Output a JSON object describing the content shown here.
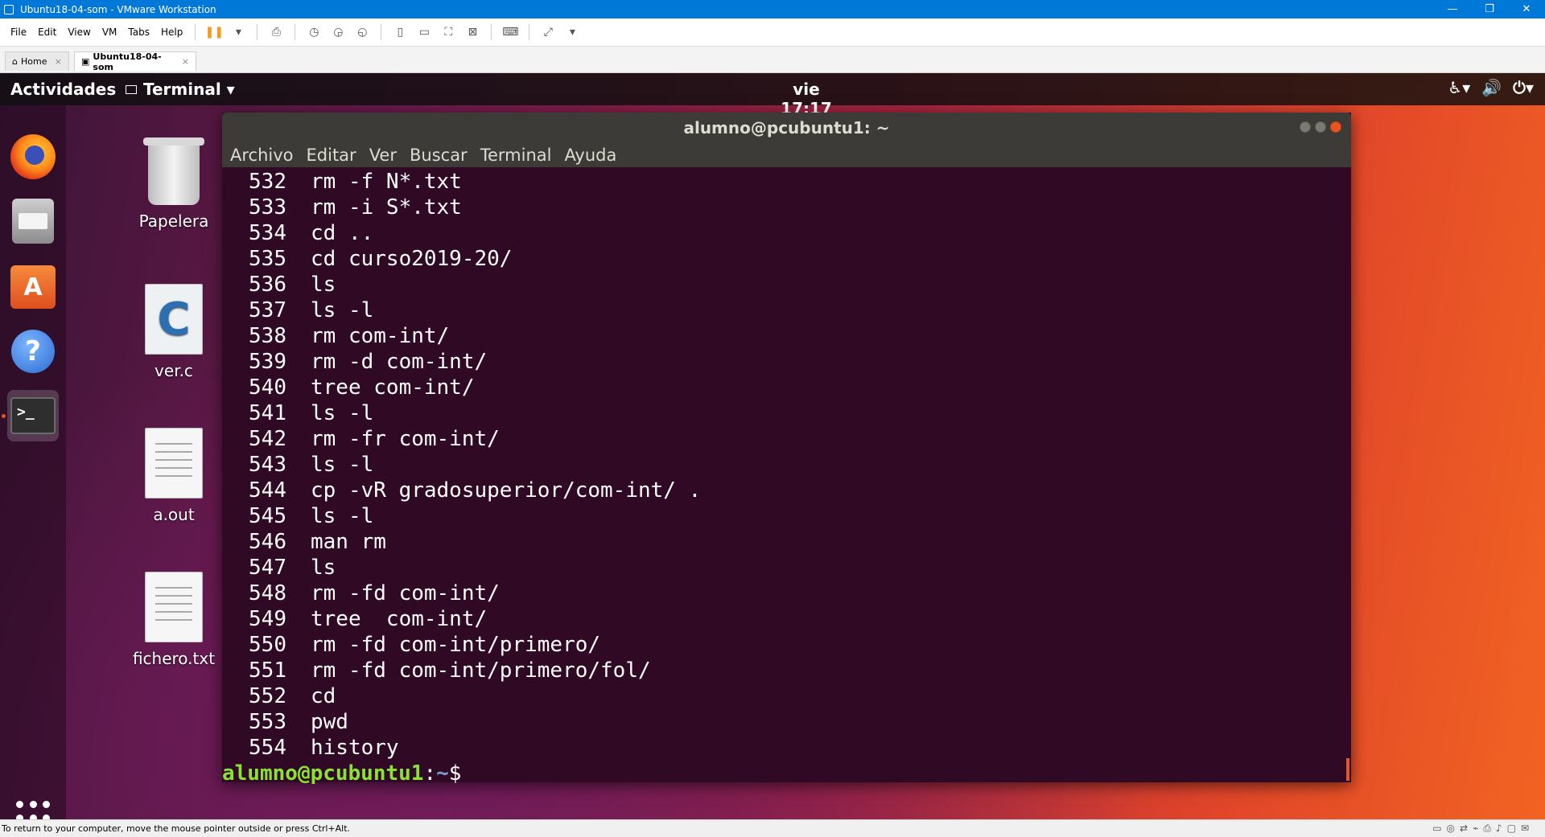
{
  "host": {
    "title": "Ubuntu18-04-som - VMware Workstation",
    "menu": [
      "File",
      "Edit",
      "View",
      "VM",
      "Tabs",
      "Help"
    ],
    "tabs": [
      {
        "label": "Home",
        "close": "×"
      },
      {
        "label": "Ubuntu18-04-som",
        "close": "×"
      }
    ],
    "status_message": "To return to your computer, move the mouse pointer outside or press Ctrl+Alt."
  },
  "gnome": {
    "activities": "Actividades",
    "app_menu": "Terminal ▾",
    "clock": "vie 17:17"
  },
  "desktop": {
    "icons": [
      {
        "label": "Papelera"
      },
      {
        "label": "ver.c"
      },
      {
        "label": "a.out"
      },
      {
        "label": "fichero.txt"
      }
    ]
  },
  "terminal": {
    "title": "alumno@pcubuntu1: ~",
    "menu": [
      "Archivo",
      "Editar",
      "Ver",
      "Buscar",
      "Terminal",
      "Ayuda"
    ],
    "history": [
      {
        "num": "532",
        "cmd": "rm -f N*.txt"
      },
      {
        "num": "533",
        "cmd": "rm -i S*.txt"
      },
      {
        "num": "534",
        "cmd": "cd .."
      },
      {
        "num": "535",
        "cmd": "cd curso2019-20/"
      },
      {
        "num": "536",
        "cmd": "ls"
      },
      {
        "num": "537",
        "cmd": "ls -l"
      },
      {
        "num": "538",
        "cmd": "rm com-int/"
      },
      {
        "num": "539",
        "cmd": "rm -d com-int/"
      },
      {
        "num": "540",
        "cmd": "tree com-int/"
      },
      {
        "num": "541",
        "cmd": "ls -l"
      },
      {
        "num": "542",
        "cmd": "rm -fr com-int/"
      },
      {
        "num": "543",
        "cmd": "ls -l"
      },
      {
        "num": "544",
        "cmd": "cp -vR gradosuperior/com-int/ ."
      },
      {
        "num": "545",
        "cmd": "ls -l"
      },
      {
        "num": "546",
        "cmd": "man rm"
      },
      {
        "num": "547",
        "cmd": "ls"
      },
      {
        "num": "548",
        "cmd": "rm -fd com-int/"
      },
      {
        "num": "549",
        "cmd": "tree  com-int/"
      },
      {
        "num": "550",
        "cmd": "rm -fd com-int/primero/"
      },
      {
        "num": "551",
        "cmd": "rm -fd com-int/primero/fol/"
      },
      {
        "num": "552",
        "cmd": "cd"
      },
      {
        "num": "553",
        "cmd": "pwd"
      },
      {
        "num": "554",
        "cmd": "history"
      }
    ],
    "prompt": {
      "user": "alumno@pcubuntu1",
      "sep": ":",
      "path": "~",
      "symbol": "$"
    }
  }
}
